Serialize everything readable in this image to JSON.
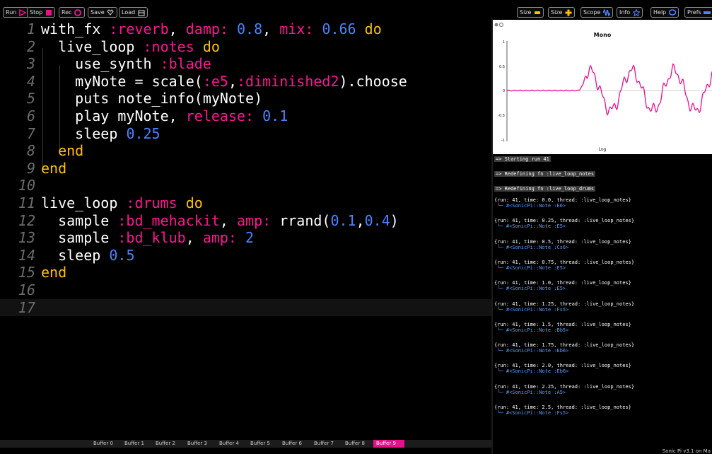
{
  "toolbar": {
    "left": [
      {
        "label": "Run",
        "icon": "play-icon"
      },
      {
        "label": "Stop",
        "icon": "stop-icon"
      },
      {
        "label": "Rec",
        "icon": "record-icon"
      },
      {
        "label": "Save",
        "icon": "save-icon"
      },
      {
        "label": "Load",
        "icon": "load-icon"
      }
    ],
    "right": [
      {
        "label": "Size",
        "icon": "minus-icon"
      },
      {
        "label": "Size",
        "icon": "plus-icon"
      },
      {
        "label": "Scope",
        "icon": "scope-icon"
      },
      {
        "label": "Info",
        "icon": "star-icon"
      },
      {
        "label": "Help",
        "icon": "help-icon"
      },
      {
        "label": "Prefs",
        "icon": "prefs-icon"
      }
    ]
  },
  "editor": {
    "lines": [
      {
        "num": "1",
        "text": "with_fx :reverb, damp: 0.8, mix: 0.66 do"
      },
      {
        "num": "2",
        "text": "  live_loop :notes do"
      },
      {
        "num": "3",
        "text": "    use_synth :blade"
      },
      {
        "num": "4",
        "text": "    myNote = scale(:e5,:diminished2).choose"
      },
      {
        "num": "5",
        "text": "    puts note_info(myNote)"
      },
      {
        "num": "6",
        "text": "    play myNote, release: 0.1"
      },
      {
        "num": "7",
        "text": "    sleep 0.25"
      },
      {
        "num": "8",
        "text": "  end"
      },
      {
        "num": "9",
        "text": "end"
      },
      {
        "num": "10",
        "text": ""
      },
      {
        "num": "11",
        "text": "live_loop :drums do"
      },
      {
        "num": "12",
        "text": "  sample :bd_mehackit, amp: rrand(0.1,0.4)"
      },
      {
        "num": "13",
        "text": "  sample :bd_klub, amp: 2"
      },
      {
        "num": "14",
        "text": "  sleep 0.5"
      },
      {
        "num": "15",
        "text": "end"
      },
      {
        "num": "16",
        "text": ""
      },
      {
        "num": "17",
        "text": ""
      }
    ],
    "current_line": 17
  },
  "buffers": {
    "tabs": [
      "Buffer 0",
      "Buffer 1",
      "Buffer 2",
      "Buffer 3",
      "Buffer 4",
      "Buffer 5",
      "Buffer 6",
      "Buffer 7",
      "Buffer 8",
      "Buffer 9"
    ],
    "active": 9,
    "active_color": "#e8108a"
  },
  "scope": {
    "title": "Mono",
    "xlabel": "Log",
    "yticks": [
      "1",
      "0.5",
      "0",
      "-0.5",
      "-1"
    ],
    "wave_color": "#e8108a"
  },
  "log": {
    "headers": [
      "=> Starting run 41",
      "=> Redefining fn :live_loop_notes",
      "=> Redefining fn :live_loop_drums"
    ],
    "entries": [
      {
        "run": "{run: 41, time: 0.0, thread: :live_loop_notes}",
        "note": " └─ #<SonicPi::Note :E6>"
      },
      {
        "run": "{run: 41, time: 0.25, thread: :live_loop_notes}",
        "note": " └─ #<SonicPi::Note :E5>"
      },
      {
        "run": "{run: 41, time: 0.5, thread: :live_loop_notes}",
        "note": " └─ #<SonicPi::Note :Cs6>"
      },
      {
        "run": "{run: 41, time: 0.75, thread: :live_loop_notes}",
        "note": " └─ #<SonicPi::Note :E5>"
      },
      {
        "run": "{run: 41, time: 1.0, thread: :live_loop_notes}",
        "note": " └─ #<SonicPi::Note :E5>"
      },
      {
        "run": "{run: 41, time: 1.25, thread: :live_loop_notes}",
        "note": " └─ #<SonicPi::Note :Fs5>"
      },
      {
        "run": "{run: 41, time: 1.5, thread: :live_loop_notes}",
        "note": " └─ #<SonicPi::Note :Bb5>"
      },
      {
        "run": "{run: 41, time: 1.75, thread: :live_loop_notes}",
        "note": " └─ #<SonicPi::Note :Eb6>"
      },
      {
        "run": "{run: 41, time: 2.0, thread: :live_loop_notes}",
        "note": " └─ #<SonicPi::Note :Eb6>"
      },
      {
        "run": "{run: 41, time: 2.25, thread: :live_loop_notes}",
        "note": " └─ #<SonicPi::Note :A5>"
      },
      {
        "run": "{run: 41, time: 2.5, thread: :live_loop_notes}",
        "note": " └─ #<SonicPi::Note :Fs5>"
      }
    ]
  },
  "status": {
    "version": "Sonic Pi v3.1 on Ma"
  }
}
